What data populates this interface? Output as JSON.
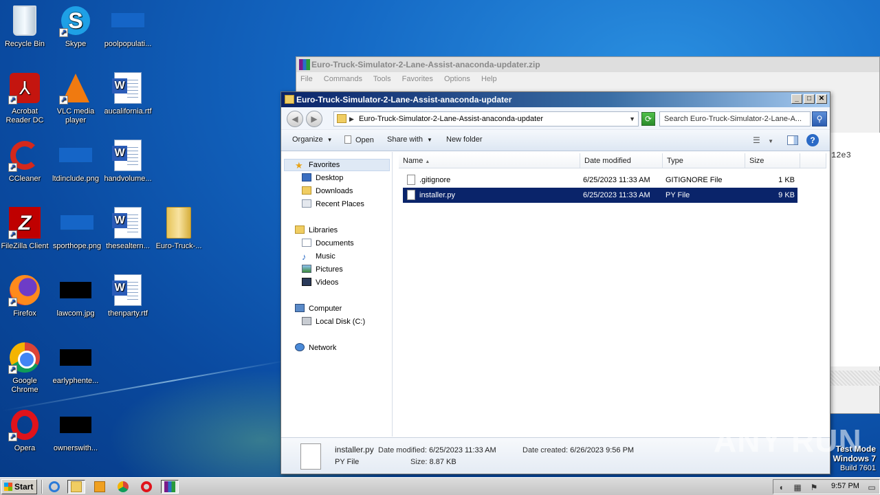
{
  "desktop": {
    "icons": [
      {
        "label": "Recycle Bin",
        "icon": "recycle-bin-icon"
      },
      {
        "label": "Skype",
        "icon": "skype-icon"
      },
      {
        "label": "poolpopulati...",
        "icon": "image-file-icon"
      },
      {
        "label": "Acrobat Reader DC",
        "icon": "acrobat-icon"
      },
      {
        "label": "VLC media player",
        "icon": "vlc-icon"
      },
      {
        "label": "aucalifornia.rtf",
        "icon": "word-document-icon"
      },
      {
        "label": "CCleaner",
        "icon": "ccleaner-icon"
      },
      {
        "label": "ltdinclude.png",
        "icon": "image-file-icon"
      },
      {
        "label": "handvolume...",
        "icon": "word-document-icon"
      },
      {
        "label": "FileZilla Client",
        "icon": "filezilla-icon"
      },
      {
        "label": "sporthope.png",
        "icon": "image-file-icon"
      },
      {
        "label": "thesealtern...",
        "icon": "word-document-icon"
      },
      {
        "label": "Euro-Truck-...",
        "icon": "folder-icon"
      },
      {
        "label": "Firefox",
        "icon": "firefox-icon"
      },
      {
        "label": "lawcom.jpg",
        "icon": "image-file-icon"
      },
      {
        "label": "thenparty.rtf",
        "icon": "word-document-icon"
      },
      {
        "label": "Google Chrome",
        "icon": "chrome-icon"
      },
      {
        "label": "earlyphente...",
        "icon": "image-file-icon"
      },
      {
        "label": "Opera",
        "icon": "opera-icon"
      },
      {
        "label": "ownerswith...",
        "icon": "image-file-icon"
      }
    ]
  },
  "winrar": {
    "title": "Euro-Truck-Simulator-2-Lane-Assist-anaconda-updater.zip",
    "menu": [
      "File",
      "Commands",
      "Tools",
      "Favorites",
      "Options",
      "Help"
    ],
    "side_text": "12e3"
  },
  "explorer": {
    "title": "Euro-Truck-Simulator-2-Lane-Assist-anaconda-updater",
    "address": "Euro-Truck-Simulator-2-Lane-Assist-anaconda-updater",
    "search_placeholder": "Search Euro-Truck-Simulator-2-Lane-A...",
    "toolbar": {
      "organize": "Organize",
      "open": "Open",
      "share_with": "Share with",
      "new_folder": "New folder"
    },
    "nav": {
      "favorites": "Favorites",
      "desktop": "Desktop",
      "downloads": "Downloads",
      "recent_places": "Recent Places",
      "libraries": "Libraries",
      "documents": "Documents",
      "music": "Music",
      "pictures": "Pictures",
      "videos": "Videos",
      "computer": "Computer",
      "local_disk": "Local Disk (C:)",
      "network": "Network"
    },
    "columns": {
      "name": "Name",
      "date_modified": "Date modified",
      "type": "Type",
      "size": "Size"
    },
    "files": [
      {
        "name": ".gitignore",
        "date": "6/25/2023 11:33 AM",
        "type": "GITIGNORE File",
        "size": "1 KB",
        "selected": false
      },
      {
        "name": "installer.py",
        "date": "6/25/2023 11:33 AM",
        "type": "PY File",
        "size": "9 KB",
        "selected": true
      }
    ],
    "details": {
      "name": "installer.py",
      "type": "PY File",
      "date_modified_label": "Date modified:",
      "date_modified": "6/25/2023 11:33 AM",
      "size_label": "Size:",
      "size": "8.87 KB",
      "date_created_label": "Date created:",
      "date_created": "6/26/2023 9:56 PM"
    }
  },
  "watermark": "ANY RUN",
  "test_mode": {
    "line1": "Test Mode",
    "line2": "Windows 7",
    "line3": "Build 7601"
  },
  "taskbar": {
    "start_label": "Start",
    "clock": "9:57 PM"
  }
}
